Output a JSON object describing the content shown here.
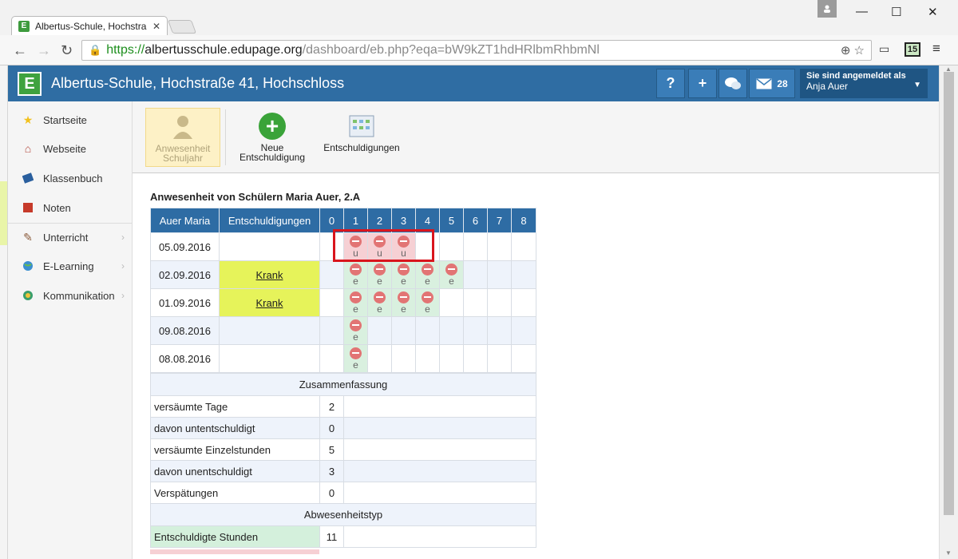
{
  "browser": {
    "tab_title": "Albertus-Schule, Hochstra",
    "url_protocol": "https://",
    "url_host": "albertusschule.edupage.org",
    "url_path": "/dashboard/eb.php?eqa=bW9kZT1hdHRlbmRhbmNl",
    "extension_badge": "15"
  },
  "header": {
    "logo": "E",
    "title": "Albertus-Schule, Hochstraße 41, Hochschloss",
    "help": "?",
    "add": "+",
    "message_count": "28",
    "user_label": "Sie sind angemeldet als",
    "user_name": "Anja Auer"
  },
  "sidebar": {
    "items": [
      {
        "label": "Startseite",
        "icon": "star-icon"
      },
      {
        "label": "Webseite",
        "icon": "house-icon"
      },
      {
        "label": "Klassenbuch",
        "icon": "book-icon"
      },
      {
        "label": "Noten",
        "icon": "grades-icon"
      },
      {
        "label": "Unterricht",
        "icon": "lesson-icon"
      },
      {
        "label": "E-Learning",
        "icon": "globe-icon"
      },
      {
        "label": "Kommunikation",
        "icon": "chat-icon"
      }
    ]
  },
  "toolbar": {
    "attendance_line1": "Anwesenheit",
    "attendance_line2": "Schuljahr",
    "new_excuse_line1": "Neue",
    "new_excuse_line2": "Entschuldigung",
    "excuses": "Entschuldigungen"
  },
  "attendance": {
    "title": "Anwesenheit von Schülern Maria Auer, 2.A",
    "col_student": "Auer Maria",
    "col_excuses": "Entschuldigungen",
    "periods": [
      "0",
      "1",
      "2",
      "3",
      "4",
      "5",
      "6",
      "7",
      "8"
    ],
    "rows": [
      {
        "date": "05.09.2016",
        "excuse": ""
      },
      {
        "date": "02.09.2016",
        "excuse": "Krank"
      },
      {
        "date": "01.09.2016",
        "excuse": "Krank"
      },
      {
        "date": "09.08.2016",
        "excuse": ""
      },
      {
        "date": "08.08.2016",
        "excuse": ""
      }
    ],
    "mark_u": "u",
    "mark_e": "e"
  },
  "summary": {
    "section_title": "Zusammenfassung",
    "rows": [
      {
        "label": "versäumte Tage",
        "value": "2"
      },
      {
        "label": "davon untentschuldigt",
        "value": "0"
      },
      {
        "label": "versäumte Einzelstunden",
        "value": "5"
      },
      {
        "label": "davon unentschuldigt",
        "value": "3"
      },
      {
        "label": "Verspätungen",
        "value": "0"
      }
    ],
    "type_section_title": "Abwesenheitstyp",
    "type_rows": [
      {
        "label": "Entschuldigte Stunden",
        "value": "11"
      }
    ]
  }
}
